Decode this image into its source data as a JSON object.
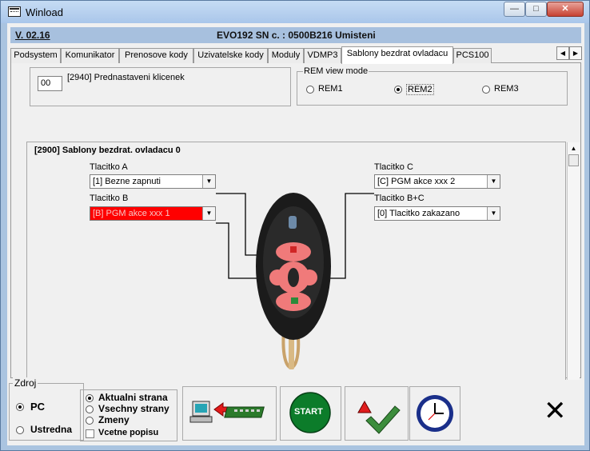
{
  "window": {
    "title": "Winload",
    "min_symbol": "—",
    "max_symbol": "□",
    "close_symbol": "✕"
  },
  "infobar": {
    "version": "V. 02.16",
    "device": "EVO192  SN c. : 0500B216 Umisteni"
  },
  "tabs": [
    {
      "label": "Podsystem"
    },
    {
      "label": "Komunikator"
    },
    {
      "label": "Prenosove kody"
    },
    {
      "label": "Uzivatelske kody"
    },
    {
      "label": "Moduly"
    },
    {
      "label": "VDMP3"
    },
    {
      "label": "Sablony bezdrat ovladacu"
    },
    {
      "label": "PCS100"
    }
  ],
  "tab_nav": {
    "left": "◀",
    "right": "▶"
  },
  "preset": {
    "code_value": "00",
    "label": "[2940] Prednastaveni klicenek"
  },
  "rem_view": {
    "legend": "REM view mode",
    "options": [
      {
        "label": "REM1",
        "selected": false
      },
      {
        "label": "REM2",
        "selected": true
      },
      {
        "label": "REM3",
        "selected": false
      }
    ]
  },
  "templates": {
    "title": "[2900] Sablony bezdrat. ovladacu  0",
    "button_a": {
      "label": "Tlacitko A",
      "value": "[1] Bezne zapnuti"
    },
    "button_b": {
      "label": "Tlacitko B",
      "value": "[B] PGM akce xxx 1",
      "highlight_color": "#ff0000"
    },
    "button_c": {
      "label": "Tlacitko C",
      "value": "[C] PGM akce xxx 2"
    },
    "button_bc": {
      "label": "Tlacitko B+C",
      "value": "[0] Tlacitko zakazano"
    },
    "dropdown_arrow": "▼"
  },
  "scrollbar": {
    "up": "▲",
    "down": "▼"
  },
  "source": {
    "legend": "Zdroj",
    "options": [
      {
        "label": "PC",
        "selected": true
      },
      {
        "label": "Ustredna",
        "selected": false
      }
    ]
  },
  "page_scope": {
    "options": [
      {
        "label": "Aktualni strana",
        "selected": true
      },
      {
        "label": "Vsechny strany",
        "selected": false
      },
      {
        "label": "Zmeny",
        "selected": false
      }
    ],
    "include_desc_label": "Vcetne popisu",
    "include_desc_checked": false
  },
  "toolbar": {
    "start_label": "START",
    "close_symbol": "✕"
  },
  "colors": {
    "accent": "#a7c0de",
    "highlight_red": "#ff0000",
    "start_green": "#0c7c2a"
  }
}
